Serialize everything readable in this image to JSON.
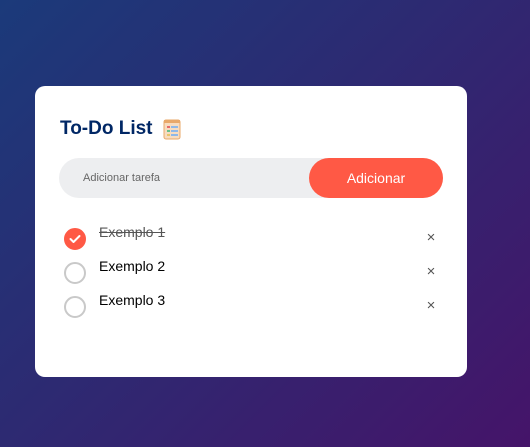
{
  "app": {
    "title": "To-Do List",
    "title_icon": "notepad-icon"
  },
  "input": {
    "placeholder": "Adicionar tarefa",
    "value": ""
  },
  "add_button": {
    "label": "Adicionar"
  },
  "colors": {
    "accent": "#ff5945",
    "title": "#002765",
    "input_bg": "#edeef0"
  },
  "tasks": [
    {
      "text": "Exemplo 1",
      "checked": true
    },
    {
      "text": "Exemplo 2",
      "checked": false
    },
    {
      "text": "Exemplo 3",
      "checked": false
    }
  ],
  "delete_symbol": "×"
}
